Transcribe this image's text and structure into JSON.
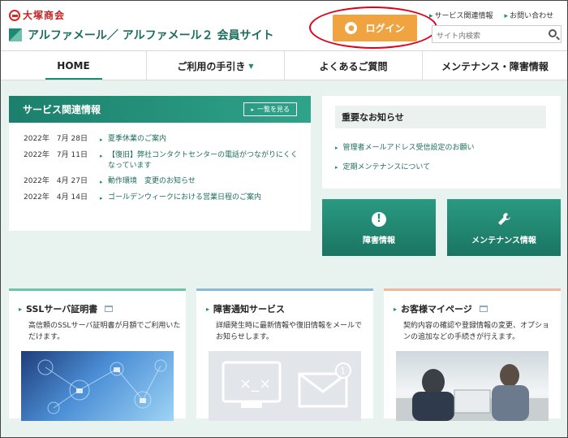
{
  "header": {
    "company_logo": "大塚商会",
    "site_title": "アルファメール／ アルファメール２ 会員サイト",
    "login_label": "ログイン",
    "top_links": [
      "サービス関連情報",
      "お問い合わせ"
    ],
    "search_placeholder": "サイト内検索"
  },
  "nav": {
    "items": [
      "HOME",
      "ご利用の手引き",
      "よくあるご質問",
      "メンテナンス・障害情報"
    ]
  },
  "service": {
    "title": "サービス関連情報",
    "list_button": "一覧を見る",
    "news": [
      {
        "date": "2022年　7月 28日",
        "text": "夏季休業のご案内"
      },
      {
        "date": "2022年　7月 11日",
        "text": "【復旧】弊社コンタクトセンターの電話がつながりにくくなっています"
      },
      {
        "date": "2022年　4月 27日",
        "text": "動作環境　変更のお知らせ"
      },
      {
        "date": "2022年　4月 14日",
        "text": "ゴールデンウィークにおける営業日程のご案内"
      }
    ]
  },
  "notice": {
    "title": "重要なお知らせ",
    "items": [
      "管理者メールアドレス受信設定のお願い",
      "定期メンテナンスについて"
    ]
  },
  "tiles": {
    "failure": "障害情報",
    "maintenance": "メンテナンス情報"
  },
  "cards": [
    {
      "title": "SSLサーバ証明書",
      "desc": "高信頼のSSLサーバ証明書が月額でご利用いただけます。"
    },
    {
      "title": "障害通知サービス",
      "desc": "詳細発生時に最新情報や復旧情報をメールでお知らせします。"
    },
    {
      "title": "お客様マイページ",
      "desc": "契約内容の確認や登録情報の変更、オプションの追加などの手続きが行えます。"
    }
  ],
  "colors": {
    "brand": "#1d8a73",
    "login": "#f0a441",
    "highlight_ring": "#e0001a"
  }
}
